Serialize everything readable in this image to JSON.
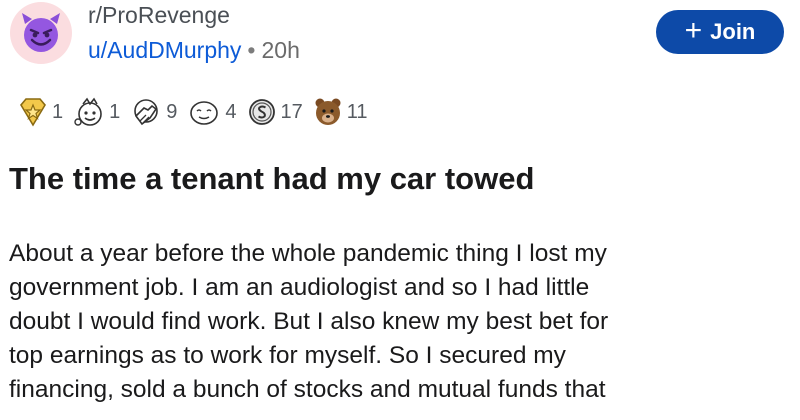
{
  "header": {
    "subreddit": "r/ProRevenge",
    "username": "u/AudDMurphy",
    "separator": "•",
    "age": "20h",
    "join_label": "Join",
    "join_icon": "+",
    "avatar_icon": "smiling-devil-icon"
  },
  "awards": [
    {
      "icon": "star-medal-icon",
      "count": "1"
    },
    {
      "icon": "wholesome-face-icon",
      "count": "1"
    },
    {
      "icon": "facepalm-face-icon",
      "count": "9"
    },
    {
      "icon": "relieved-face-icon",
      "count": "4"
    },
    {
      "icon": "silver-coin-icon",
      "count": "17"
    },
    {
      "icon": "bear-face-icon",
      "count": "11"
    }
  ],
  "post": {
    "title": "The time a tenant had my car towed",
    "body_lines": [
      "About a year before the whole pandemic thing I lost my",
      "government job. I am an audiologist and so I had little",
      "doubt I would find work. But I also knew my best bet for",
      "top earnings as to work for myself. So I secured my",
      "financing, sold a bunch of stocks and mutual funds that"
    ]
  },
  "colors": {
    "join_button": "#0d4aa8",
    "username": "#0d5bd7",
    "avatar_bg": "#fbdde0",
    "devil": "#8a4fd8"
  }
}
